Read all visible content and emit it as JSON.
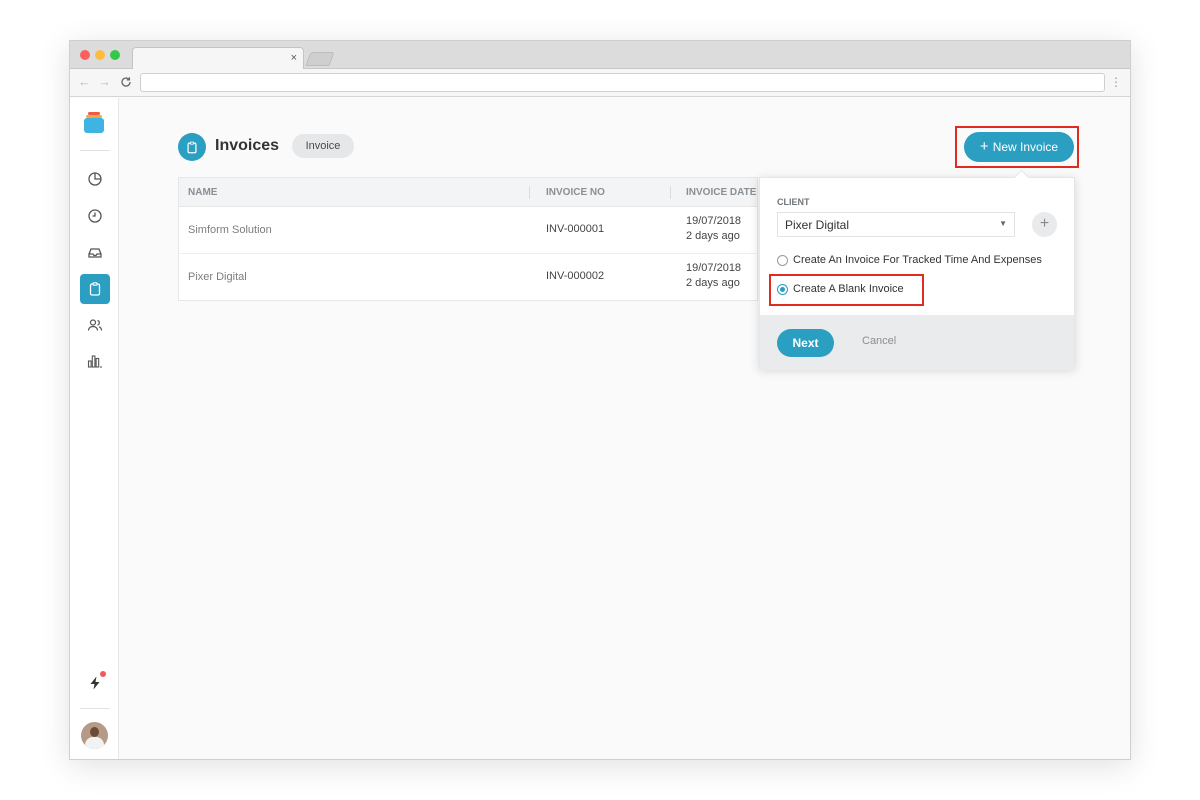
{
  "browser": {
    "tab_close": "×",
    "nav_back": "←",
    "nav_forward": "→",
    "nav_reload": "C",
    "menu": "⋮"
  },
  "sidebar": {
    "items": [
      {
        "name": "sidebar-item-dashboard",
        "icon": "pie-chart-icon"
      },
      {
        "name": "sidebar-item-time",
        "icon": "clock-icon"
      },
      {
        "name": "sidebar-item-inbox",
        "icon": "inbox-icon"
      },
      {
        "name": "sidebar-item-invoices",
        "icon": "clipboard-icon",
        "active": true
      },
      {
        "name": "sidebar-item-team",
        "icon": "users-icon"
      },
      {
        "name": "sidebar-item-reports",
        "icon": "bar-chart-icon"
      }
    ],
    "bottom": [
      {
        "name": "sidebar-item-activity",
        "icon": "lightning-icon"
      },
      {
        "name": "user-avatar",
        "icon": "avatar"
      }
    ]
  },
  "header": {
    "title": "Invoices",
    "chip": "Invoice",
    "new_button": "New Invoice",
    "new_button_plus": "+"
  },
  "table": {
    "columns": [
      "NAME",
      "INVOICE NO",
      "INVOICE DATE"
    ],
    "rows": [
      {
        "name": "Simform Solution",
        "invoice_no": "INV-000001",
        "date": "19/07/2018",
        "relative": "2 days ago"
      },
      {
        "name": "Pixer Digital",
        "invoice_no": "INV-000002",
        "date": "19/07/2018",
        "relative": "2 days ago"
      }
    ]
  },
  "popover": {
    "client_label": "CLIENT",
    "client_value": "Pixer Digital",
    "select_arrow": "▼",
    "add_client": "+",
    "options": [
      {
        "label": "Create An Invoice For Tracked Time And Expenses",
        "checked": false
      },
      {
        "label": "Create A Blank Invoice",
        "checked": true
      }
    ],
    "next": "Next",
    "cancel": "Cancel"
  },
  "colors": {
    "accent": "#2a9fc1",
    "highlight": "#e02b20"
  }
}
